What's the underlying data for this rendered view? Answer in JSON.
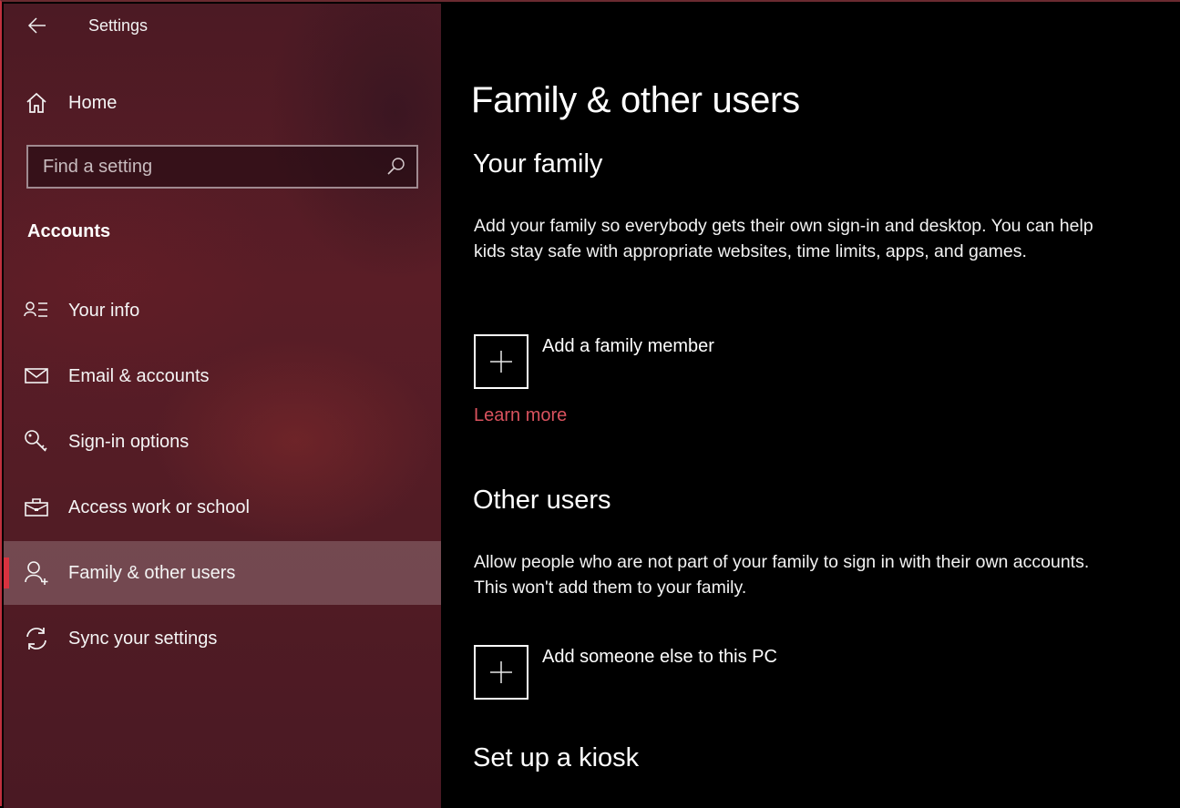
{
  "window": {
    "title": "Settings",
    "accent_color": "#d9323f",
    "link_color": "#d9525e"
  },
  "sidebar": {
    "back_icon": "back-arrow-icon",
    "home": {
      "label": "Home",
      "icon": "home-icon"
    },
    "search": {
      "placeholder": "Find a setting",
      "value": "",
      "icon": "search-icon"
    },
    "section_label": "Accounts",
    "items": [
      {
        "label": "Your info",
        "icon": "contact-info-icon",
        "selected": false
      },
      {
        "label": "Email & accounts",
        "icon": "mail-icon",
        "selected": false
      },
      {
        "label": "Sign-in options",
        "icon": "key-icon",
        "selected": false
      },
      {
        "label": "Access work or school",
        "icon": "briefcase-icon",
        "selected": false
      },
      {
        "label": "Family & other users",
        "icon": "add-person-icon",
        "selected": true
      },
      {
        "label": "Sync your settings",
        "icon": "sync-icon",
        "selected": false
      }
    ]
  },
  "main": {
    "title": "Family & other users",
    "your_family": {
      "heading": "Your family",
      "description": "Add your family so everybody gets their own sign-in and desktop. You can help kids stay safe with appropriate websites, time limits, apps, and games.",
      "add_label": "Add a family member",
      "learn_more": "Learn more"
    },
    "other_users": {
      "heading": "Other users",
      "description": "Allow people who are not part of your family to sign in with their own accounts. This won't add them to your family.",
      "add_label": "Add someone else to this PC"
    },
    "kiosk": {
      "heading": "Set up a kiosk"
    }
  }
}
